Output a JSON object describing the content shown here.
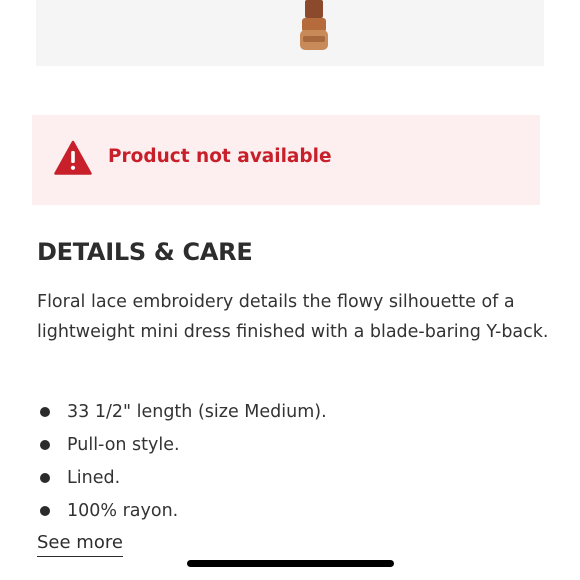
{
  "product_image": {
    "icon": "shoe-image"
  },
  "alert": {
    "icon": "warning-triangle-icon",
    "message": "Product not available",
    "color": "#c8202a",
    "background": "#fdeff0"
  },
  "details": {
    "title": "DETAILS & CARE",
    "description": "Floral lace embroidery details the flowy silhouette of a lightweight mini dress finished with a blade-baring Y-back.",
    "bullets": [
      "33 1/2\" length (size Medium).",
      "Pull-on style.",
      "Lined.",
      "100% rayon."
    ],
    "see_more_label": "See more"
  }
}
